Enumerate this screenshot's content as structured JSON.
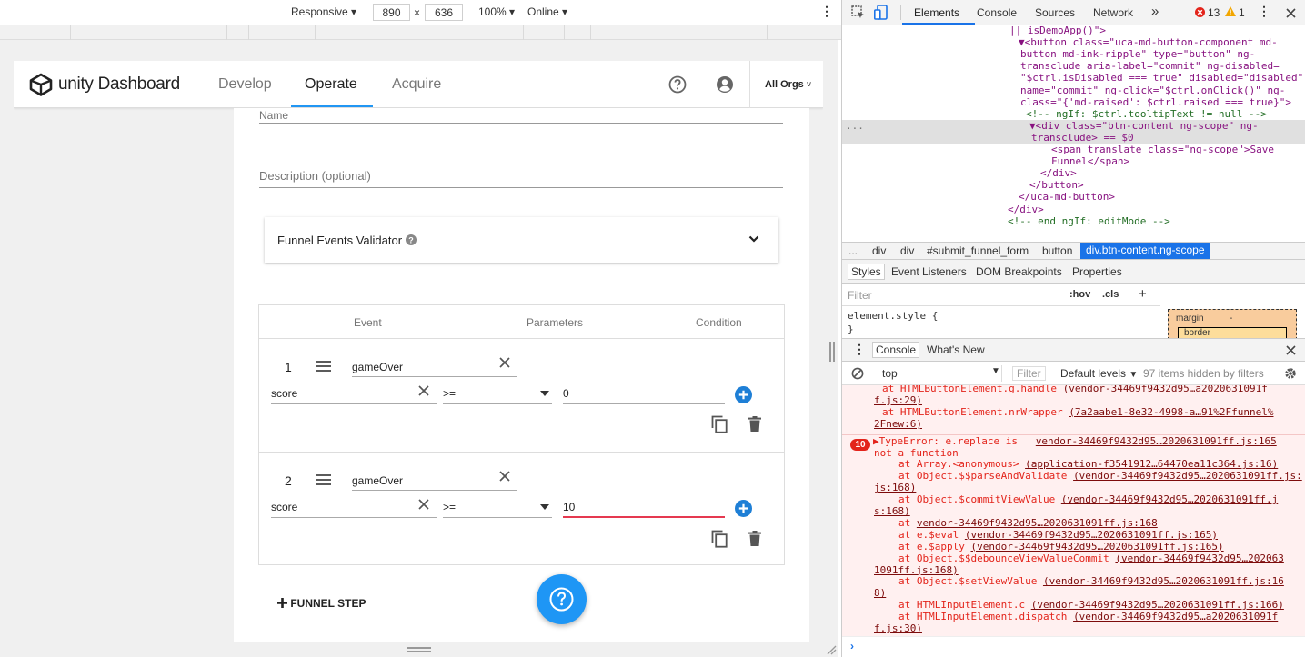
{
  "device_toolbar": {
    "device": "Responsive",
    "width": "890",
    "times": "×",
    "height": "636",
    "zoom": "100%",
    "throttle": "Online"
  },
  "app": {
    "logo_text": "unity Dashboard",
    "nav": [
      "Develop",
      "Operate",
      "Acquire"
    ],
    "active_nav": "Operate",
    "org_selector": "All Orgs"
  },
  "form": {
    "name_label": "Name",
    "description_placeholder": "Description (optional)",
    "validator_title": "Funnel Events Validator",
    "columns": [
      "Event",
      "Parameters",
      "Condition"
    ],
    "steps": [
      {
        "number": "1",
        "event": "gameOver",
        "param": "score",
        "operator": ">=",
        "value": "0"
      },
      {
        "number": "2",
        "event": "gameOver",
        "param": "score",
        "operator": ">=",
        "value": "10"
      }
    ],
    "add_step_label": "FUNNEL STEP"
  },
  "devtools": {
    "tabs": [
      "Elements",
      "Console",
      "Sources",
      "Network"
    ],
    "more_tabs": "»",
    "active_tab": "Elements",
    "error_count": "13",
    "warning_count": "1",
    "breadcrumbs": [
      "...",
      "div",
      "div",
      "#submit_funnel_form",
      "button",
      "div.btn-content.ng-scope"
    ],
    "styles_tabs": [
      "Styles",
      "Event Listeners",
      "DOM Breakpoints",
      "Properties"
    ],
    "filter_placeholder": "Filter",
    "hov": ":hov",
    "cls": ".cls",
    "element_style": "element.style {",
    "element_style_close": "}",
    "box_margin": "margin",
    "box_margin_val": "-",
    "box_border": "border",
    "console_tabs": [
      "Console",
      "What's New"
    ],
    "context": "top",
    "console_filter": "Filter",
    "levels": "Default levels",
    "hidden_msg": "97 items hidden by filters",
    "error_badge": "10"
  },
  "elements_html": [
    {
      "cls": "",
      "t": "|| isDemoApp()\">"
    },
    {
      "cls": "tri",
      "t": "<button class=\"uca-md-button-component md-"
    },
    {
      "cls": "",
      "t": "button md-ink-ripple\" type=\"button\" ng-"
    },
    {
      "cls": "",
      "t": "transclude aria-label=\"commit\" ng-disabled="
    },
    {
      "cls": "",
      "t": "\"$ctrl.isDisabled === true\" disabled=\"disabled\""
    },
    {
      "cls": "",
      "t": "name=\"commit\" ng-click=\"$ctrl.onClick()\" ng-"
    },
    {
      "cls": "",
      "t": "class=\"{'md-raised': $ctrl.raised === true}\">"
    },
    {
      "cls": "cm",
      "t": "<!-- ngIf: $ctrl.tooltipText != null -->"
    },
    {
      "cls": "tri",
      "t": "<div class=\"btn-content ng-scope\" ng-"
    },
    {
      "cls": "",
      "t": "transclude> == $0"
    },
    {
      "cls": "",
      "t": "<span translate class=\"ng-scope\">Save"
    },
    {
      "cls": "",
      "t": "Funnel</span>"
    },
    {
      "cls": "",
      "t": "</div>"
    },
    {
      "cls": "",
      "t": "</button>"
    },
    {
      "cls": "",
      "t": "</uca-md-button>"
    },
    {
      "cls": "",
      "t": "</div>"
    },
    {
      "cls": "cm",
      "t": "<!-- end ngIf: editMode -->"
    }
  ],
  "console_lines": [
    {
      "t": "at HTMLButtonElement.g.handle ",
      "lk": "(vendor-34469f9432d95…a2020631091f"
    },
    {
      "t": "",
      "lk": "f.js:29)"
    },
    {
      "t": "at HTMLButtonElement.nrWrapper ",
      "lk": "(7a2aabe1-8e32-4998-a…91%2Ffunnel%"
    },
    {
      "t": "",
      "lk": "2Fnew:6)"
    },
    {
      "t": "▶TypeError: e.replace is   ",
      "lk": "vendor-34469f9432d95…2020631091ff.js:165"
    },
    {
      "t": "not a function",
      "lk": ""
    },
    {
      "t": "at Array.<anonymous> ",
      "lk": "(application-f3541912…64470ea11c364.js:16)"
    },
    {
      "t": "at Object.$$parseAndValidate ",
      "lk": "(vendor-34469f9432d95…2020631091ff.js:"
    },
    {
      "t": "",
      "lk": "js:168)"
    },
    {
      "t": "at Object.$commitViewValue ",
      "lk": "(vendor-34469f9432d95…2020631091ff.j"
    },
    {
      "t": "",
      "lk": "s:168)"
    },
    {
      "t": "at ",
      "lk": "vendor-34469f9432d95…2020631091ff.js:168"
    },
    {
      "t": "at e.$eval ",
      "lk": "(vendor-34469f9432d95…2020631091ff.js:165)"
    },
    {
      "t": "at e.$apply ",
      "lk": "(vendor-34469f9432d95…2020631091ff.js:165)"
    },
    {
      "t": "at Object.$$debounceViewValueCommit ",
      "lk": "(vendor-34469f9432d95…202063"
    },
    {
      "t": "",
      "lk": "1091ff.js:168)"
    },
    {
      "t": "at Object.$setViewValue ",
      "lk": "(vendor-34469f9432d95…2020631091ff.js:16"
    },
    {
      "t": "",
      "lk": "8)"
    },
    {
      "t": "at HTMLInputElement.c ",
      "lk": "(vendor-34469f9432d95…2020631091ff.js:166)"
    },
    {
      "t": "at HTMLInputElement.dispatch ",
      "lk": "(vendor-34469f9432d95…a2020631091f"
    },
    {
      "t": "",
      "lk": "f.js:30)"
    }
  ],
  "colors": {
    "accent": "#2196f3",
    "fab": "#1e96f5",
    "error": "#e3241b",
    "invalid": "#e53950"
  }
}
